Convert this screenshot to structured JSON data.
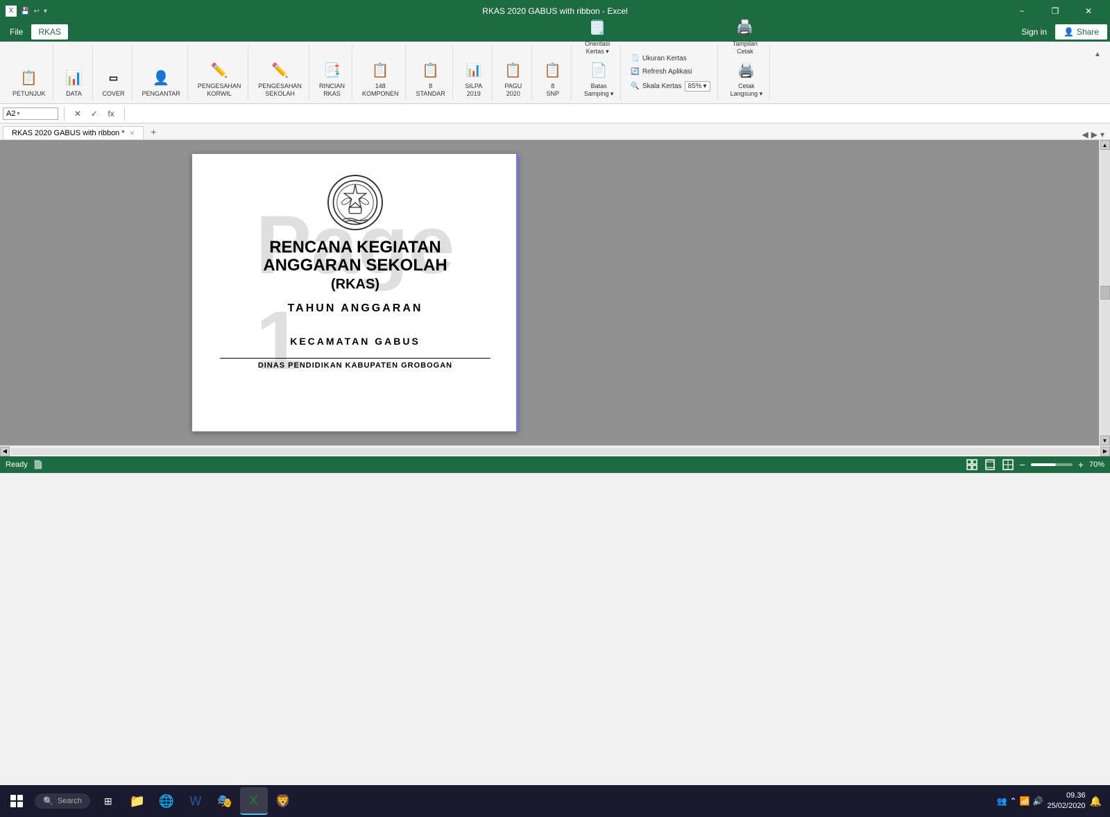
{
  "window": {
    "title": "RKAS 2020 GABUS with ribbon - Excel",
    "minimize_label": "−",
    "restore_label": "❐",
    "close_label": "✕"
  },
  "menu": {
    "file_label": "File",
    "rkas_label": "RKAS",
    "signin_label": "Sign in",
    "share_label": "Share"
  },
  "ribbon": {
    "petunjuk_label": "PETUNJUK",
    "data_label": "DATA",
    "cover_label": "COVER",
    "pengantar_label": "PENGANTAR",
    "pengesahan_korwil_label": "PENGESAHAN\nKORWIL",
    "pengesahan_sekolah_label": "PENGESAHAN\nSEKOLAH",
    "rincian_rkas_label": "RINCIAN\nRKAS",
    "komponen_148_label": "148\nKOMPONEN",
    "standar_8_label": "8\nSTANDAR",
    "silpa_2019_label": "SILPA\n2019",
    "pagu_2020_label": "PAGU\n2020",
    "snp_8_label": "8\nSNP",
    "orientasi_kertas_label": "Orientasi\nKertas",
    "batas_samping_label": "Batas\nSamping",
    "ukuran_kertas_label": "Ukuran Kertas",
    "refresh_aplikasi_label": "Refresh Aplikasi",
    "skala_kertas_label": "Skala Kertas",
    "skala_value": "85%",
    "tampilan_cetak_label": "Tampilan\nCetak",
    "cetak_langsung_label": "Cetak\nLangsung"
  },
  "formula_bar": {
    "cell_ref": "A2",
    "cancel_label": "✕",
    "confirm_label": "✓",
    "function_label": "fx"
  },
  "sheet_tab": {
    "name": "RKAS 2020 GABUS with ribbon *",
    "add_label": "+"
  },
  "document": {
    "title_line1": "RENCANA KEGIATAN ANGGARAN SEKOLAH",
    "title_line2": "(RKAS)",
    "tahun_label": "TAHUN  ANGGARAN",
    "kecamatan_label": "KECAMATAN GABUS",
    "dinas_label": "DINAS PENDIDIKAN KABUPATEN GROBOGAN",
    "page_watermark": "Page 1"
  },
  "status_bar": {
    "ready_label": "Ready",
    "zoom_percent": "70%"
  },
  "taskbar": {
    "time": "09.36",
    "date": "25/02/2020",
    "start_label": "⊞"
  },
  "colors": {
    "excel_green": "#1e6b42",
    "ribbon_bg": "#f5f5f5",
    "grey_area": "#909090",
    "page_bg": "#ffffff",
    "taskbar_bg": "#1a1a2e"
  }
}
